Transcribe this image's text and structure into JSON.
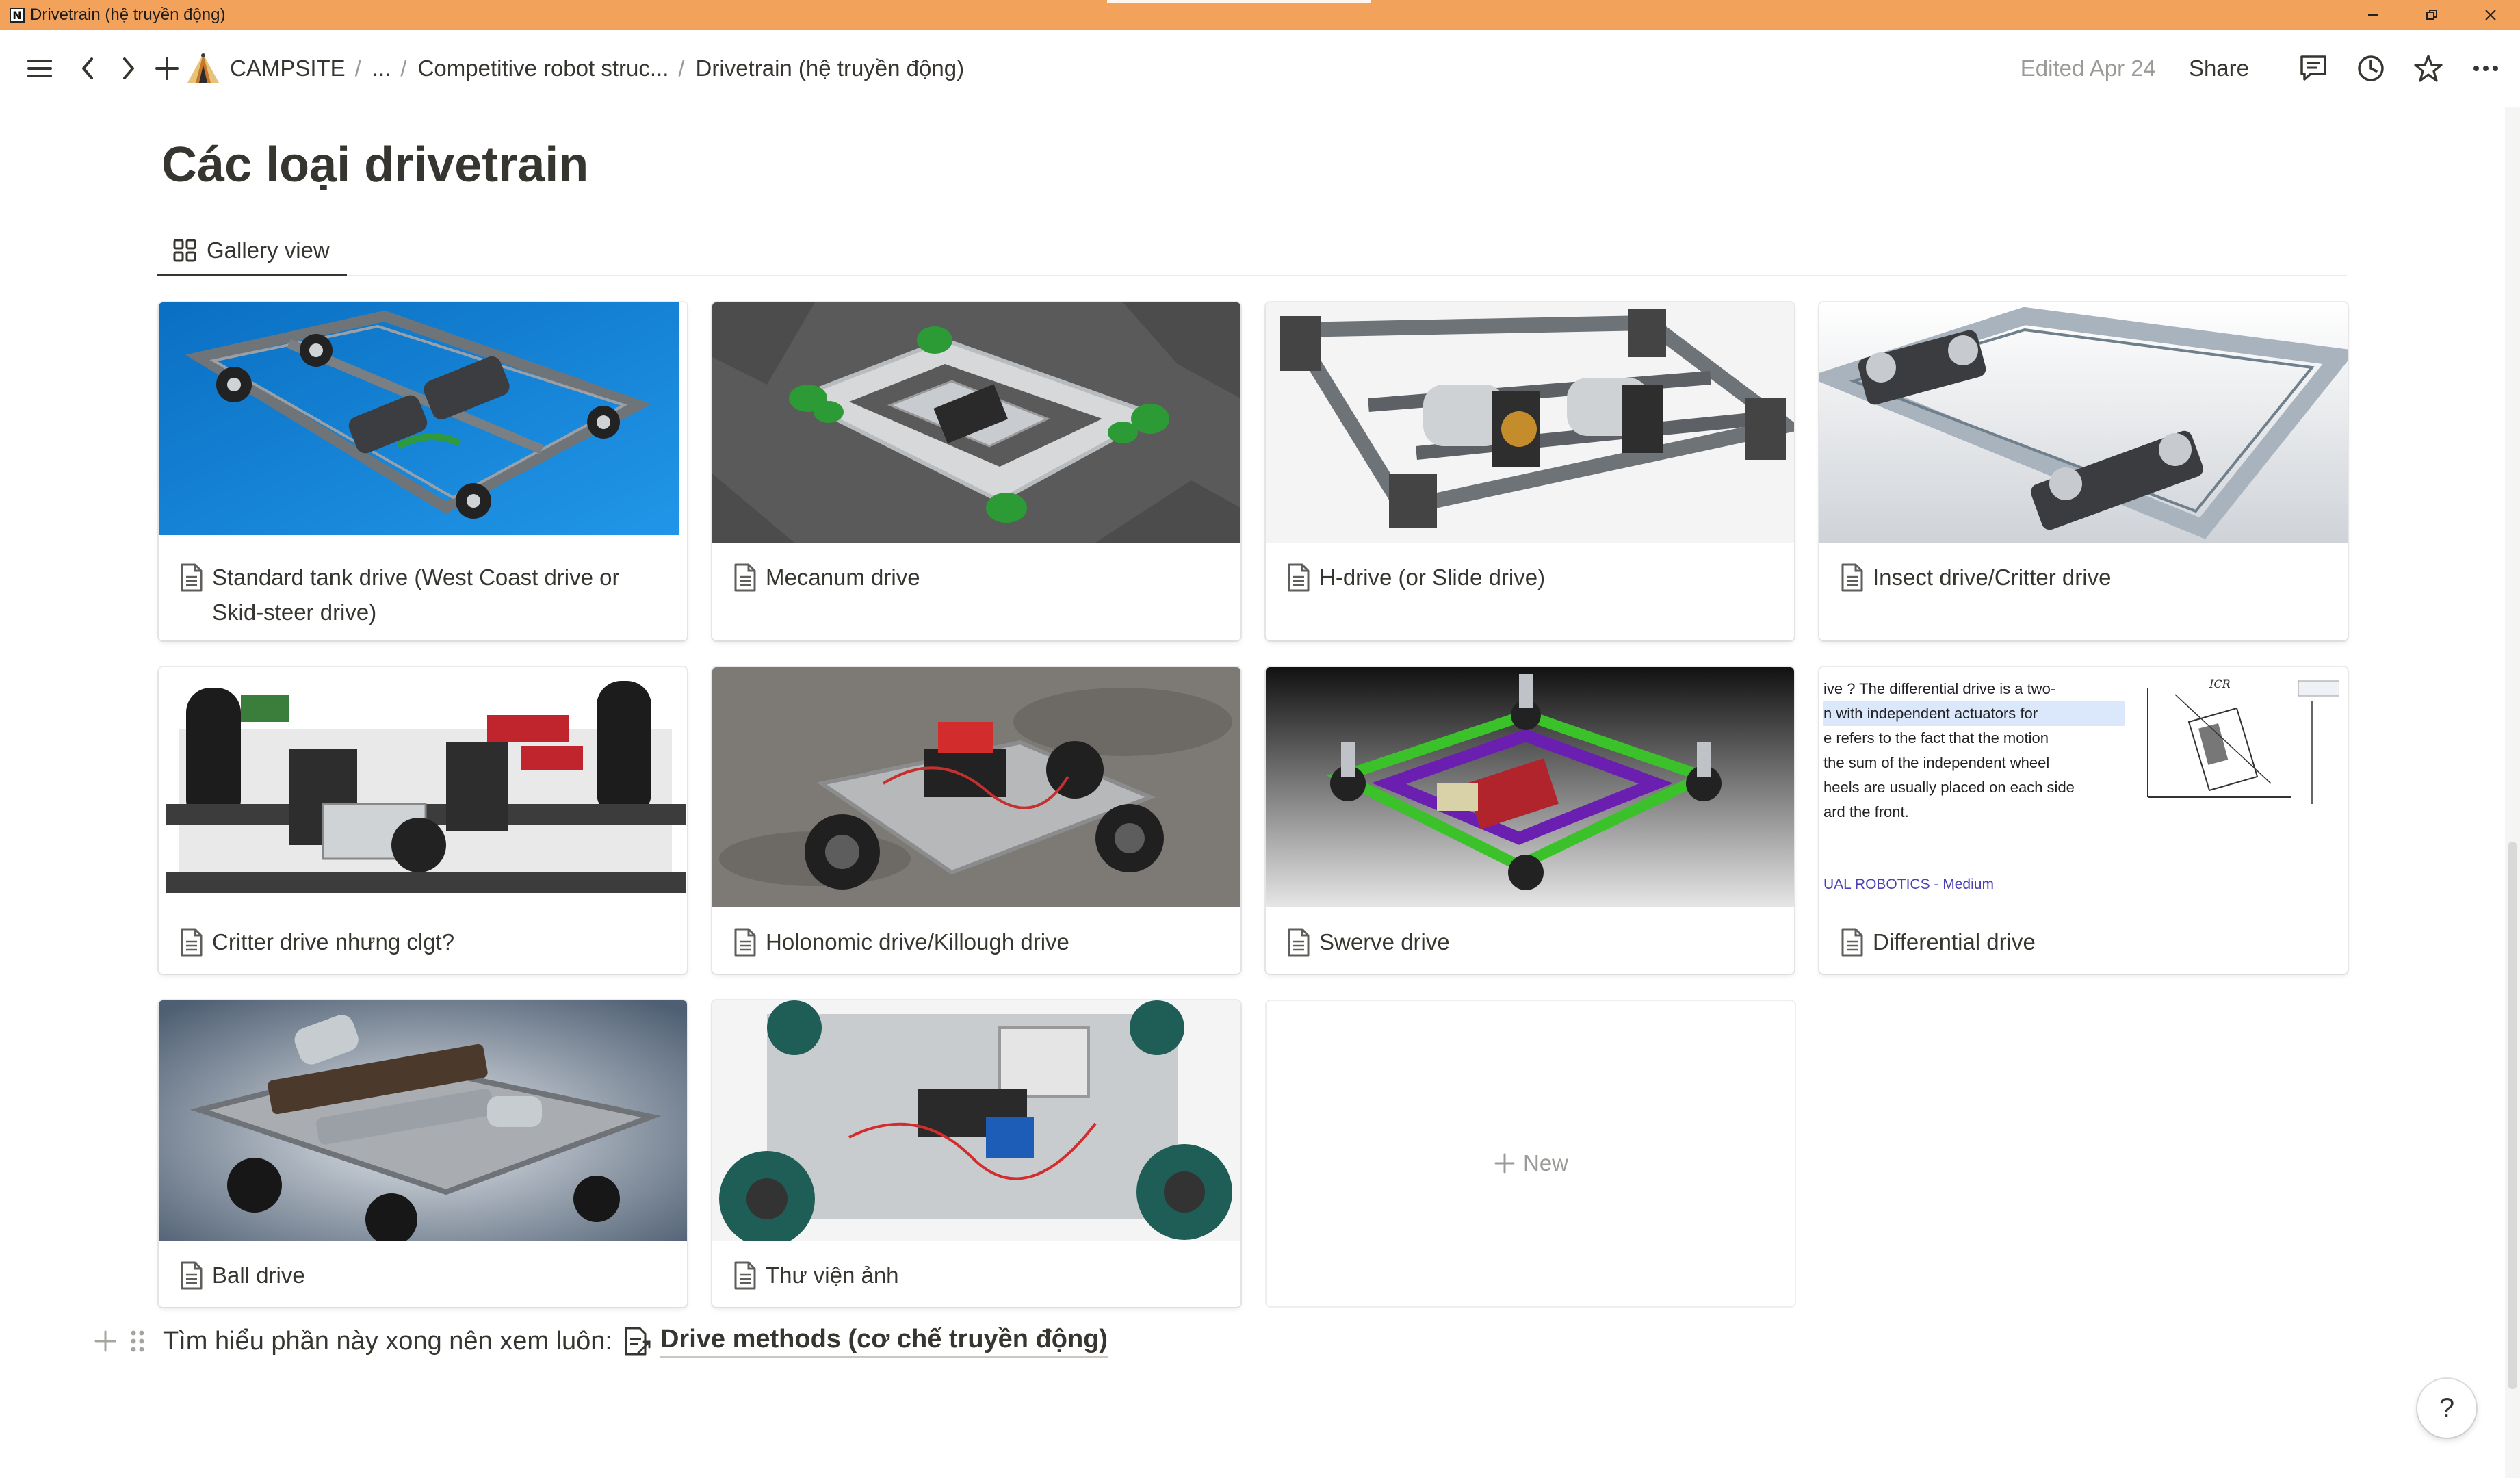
{
  "window": {
    "title": "Drivetrain (hệ truyền động)",
    "app_icon_letter": "N"
  },
  "breadcrumb": {
    "workspace": "CAMPSITE",
    "ellipsis": "...",
    "parent": "Competitive robot struc...",
    "current": "Drivetrain (hệ truyền động)"
  },
  "topbar": {
    "edited": "Edited Apr 24",
    "share": "Share"
  },
  "page": {
    "title": "Các loại drivetrain"
  },
  "view": {
    "label": "Gallery view"
  },
  "cards": [
    {
      "title": "Standard tank drive (West Coast drive or Skid-steer drive)",
      "image": "tank-drive-render"
    },
    {
      "title": "Mecanum drive",
      "image": "mecanum-drive-render"
    },
    {
      "title": "H-drive (or Slide drive)",
      "image": "h-drive-render"
    },
    {
      "title": "Insect drive/Critter drive",
      "image": "insect-drive-render"
    },
    {
      "title": "Critter drive nhưng clgt?",
      "image": "critter-drive-render"
    },
    {
      "title": "Holonomic drive/Killough drive",
      "image": "holonomic-drive-photo"
    },
    {
      "title": "Swerve drive",
      "image": "swerve-drive-render"
    },
    {
      "title": "Differential drive",
      "image": "differential-drive-article-screenshot"
    },
    {
      "title": "Ball drive",
      "image": "ball-drive-render"
    },
    {
      "title": "Thư viện ảnh",
      "image": "vex-robot-photo"
    }
  ],
  "new_card": {
    "label": "New"
  },
  "differential_snippet": {
    "lines": [
      "ive ? The differential drive is a two-",
      "n with independent actuators for",
      "e refers to the fact that the motion",
      "the sum of the independent wheel",
      "heels are usually placed on each side",
      "ard the front."
    ],
    "source": "UAL ROBOTICS - Medium",
    "icr": "ICR"
  },
  "bottom": {
    "prefix": "Tìm hiểu phần này xong nên xem luôn:",
    "link": "Drive methods (cơ chế truyền động)"
  },
  "help": {
    "label": "?"
  },
  "colors": {
    "titlebar": "#f2a25a",
    "text": "#37352f",
    "muted": "#9b9a97",
    "tank_bg": "#1e88d6",
    "vex_green": "#2f9a3c",
    "swerve_purple": "#6a1fb0"
  }
}
